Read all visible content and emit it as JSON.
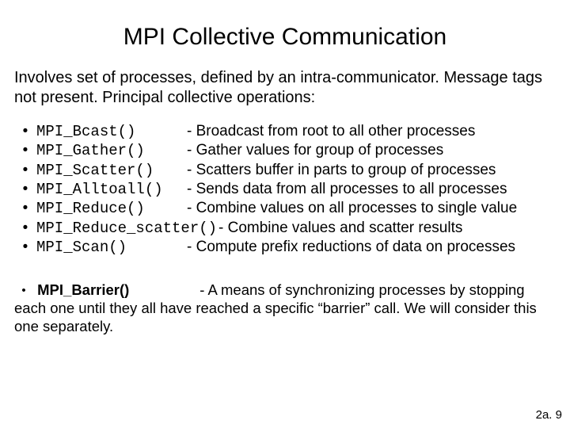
{
  "title": "MPI Collective Communication",
  "intro": "Involves set of processes, defined by an intra-communicator. Message tags not present. Principal collective operations:",
  "items": [
    {
      "func": "MPI_Bcast()",
      "desc": "- Broadcast from root to all other processes"
    },
    {
      "func": "MPI_Gather()",
      "desc": "- Gather values for group of processes"
    },
    {
      "func": "MPI_Scatter()",
      "desc": "- Scatters buffer in parts to group of processes"
    },
    {
      "func": "MPI_Alltoall()",
      "desc": "- Sends data from all processes to all processes"
    },
    {
      "func": "MPI_Reduce()",
      "desc": "- Combine values on all processes to single value"
    },
    {
      "func": "MPI_Reduce_scatter()",
      "desc": "- Combine values and scatter results"
    },
    {
      "func": "MPI_Scan()",
      "desc": "- Compute prefix reductions of data on processes"
    }
  ],
  "barrier": {
    "func": "MPI_Barrier()",
    "desc_lead": "- A means of synchronizing processes by stopping",
    "desc_rest": "each one until they all have reached a specific “barrier” call. We will consider this one separately."
  },
  "page": "2a. 9",
  "bullet": "•"
}
